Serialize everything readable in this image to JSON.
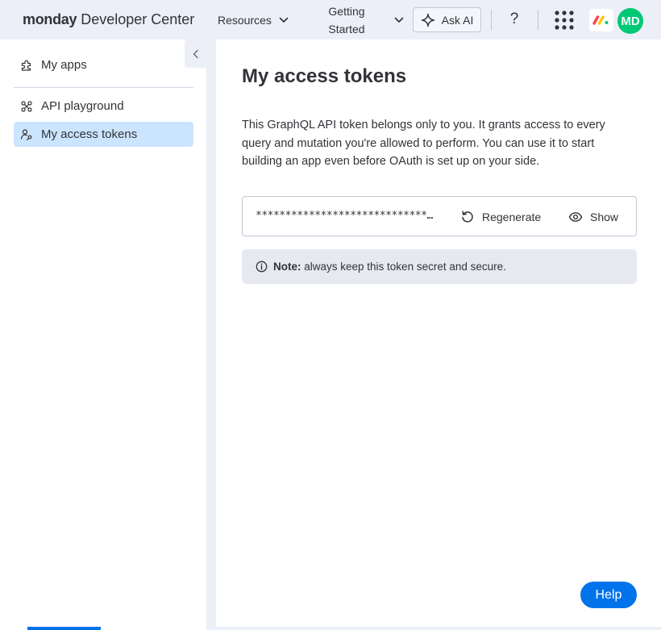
{
  "header": {
    "brand_bold": "monday",
    "brand_rest": " Developer Center",
    "nav_resources": "Resources",
    "nav_getting_started": "Getting Started",
    "ask_ai": "Ask AI",
    "help_glyph": "?",
    "avatar_initials": "MD"
  },
  "sidebar": {
    "items": [
      {
        "label": "My apps",
        "icon": "puzzle-icon"
      },
      {
        "label": "API playground",
        "icon": "playground-icon"
      },
      {
        "label": "My access tokens",
        "icon": "token-user-icon",
        "active": true
      }
    ]
  },
  "main": {
    "title": "My access tokens",
    "description": "This GraphQL API token belongs only to you. It grants access to every query and mutation you're allowed to perform. You can use it to start building an app even before OAuth is set up on your side.",
    "token_masked": "********************************************",
    "regenerate_label": "Regenerate",
    "show_label": "Show",
    "note_bold": "Note:",
    "note_text": " always keep this token secret and secure."
  },
  "help_button": "Help",
  "colors": {
    "accent": "#0073ea",
    "active_item": "#cce5ff",
    "avatar": "#00c875",
    "page_bg": "#eceff8"
  }
}
